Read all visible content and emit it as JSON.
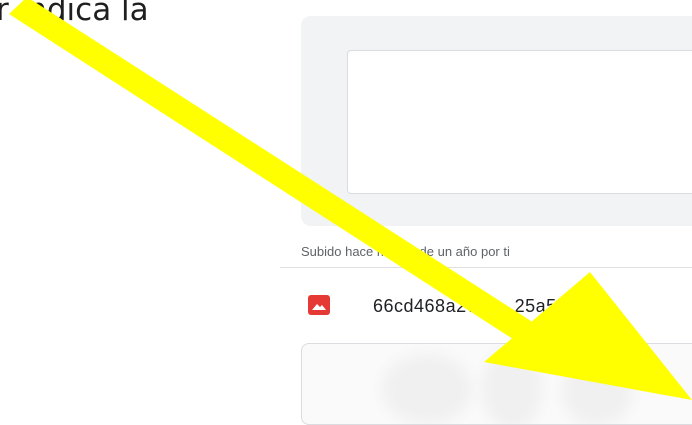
{
  "caption": {
    "text": "r indica la"
  },
  "file_panel": {
    "uploaded_text": "Subido hace menos de un año por ti",
    "file_name": "66cd468a2794...25a54f4",
    "file_icon": "image-icon"
  },
  "annotation": {
    "icon": "arrow-icon",
    "color": "#ffff00"
  }
}
